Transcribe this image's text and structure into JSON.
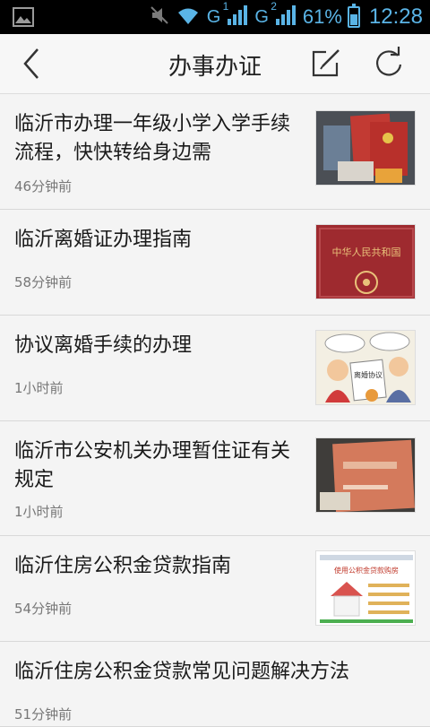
{
  "status_bar": {
    "network_1": "G",
    "network_1_sim": "1",
    "network_2": "G",
    "network_2_sim": "2",
    "battery_percent": "61%",
    "battery_level": 0.61,
    "time": "12:28",
    "icons": [
      "image-icon",
      "mute-icon",
      "wifi-icon",
      "signal-icon",
      "signal-icon",
      "battery-icon"
    ]
  },
  "header": {
    "title": "办事办证",
    "icons": [
      "back-icon",
      "edit-icon",
      "refresh-icon"
    ]
  },
  "articles": [
    {
      "title": "临沂市办理一年级小学入学手续流程，快快转给身边需",
      "time": "46分钟前",
      "thumbnail": "documents-photo"
    },
    {
      "title": "临沂离婚证办理指南",
      "time": "58分钟前",
      "thumbnail": "certificate-cover-photo",
      "thumb_caption": "中华人民共和国"
    },
    {
      "title": "协议离婚手续的办理",
      "time": "1小时前",
      "thumbnail": "cartoon-divorce-photo",
      "thumb_caption": "离婚协议"
    },
    {
      "title": "临沂市公安机关办理暂住证有关规定",
      "time": "1小时前",
      "thumbnail": "residence-permit-photo"
    },
    {
      "title": "临沂住房公积金贷款指南",
      "time": "54分钟前",
      "thumbnail": "housing-fund-flyer-photo",
      "thumb_caption": "使用公积金贷款购房"
    },
    {
      "title": "临沂住房公积金贷款常见问题解决方法",
      "time": "51分钟前"
    }
  ],
  "colors": {
    "status_accent": "#5ab4e6",
    "background": "#f4f4f4",
    "divider": "#d8d8d8",
    "time_text": "#777777"
  }
}
